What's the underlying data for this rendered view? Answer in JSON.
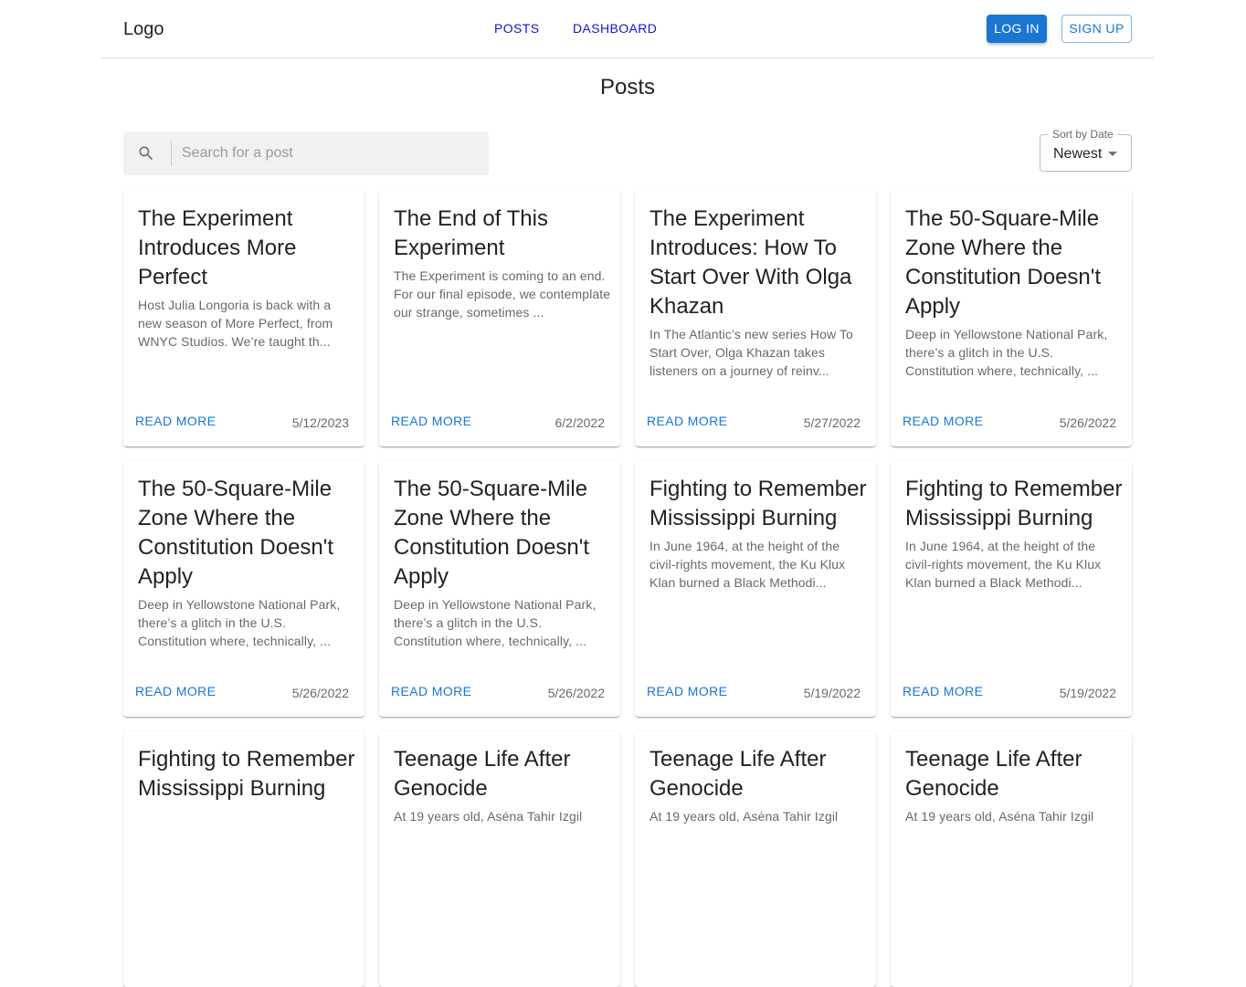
{
  "nav": {
    "logo": "Logo",
    "links": [
      "POSTS",
      "DASHBOARD"
    ],
    "login_label": "LOG IN",
    "signup_label": "SIGN UP"
  },
  "page": {
    "title": "Posts"
  },
  "search": {
    "placeholder": "Search for a post",
    "value": ""
  },
  "sort": {
    "label": "Sort by Date",
    "value": "Newest"
  },
  "colors": {
    "primary": "#1976d2",
    "nav_link": "#1515cc",
    "search_bg": "#f1f1f1"
  },
  "read_more_label": "READ MORE",
  "posts": [
    {
      "title": "The Experiment Introduces More Perfect",
      "excerpt": "Host Julia Longoria is back with a new season of More Perfect, from WNYC Studios. We’re taught th...",
      "date": "5/12/2023"
    },
    {
      "title": "The End of This Experiment",
      "excerpt": "The Experiment is coming to an end. For our final episode, we contemplate our strange, sometimes ...",
      "date": "6/2/2022"
    },
    {
      "title": "The Experiment Introduces: How To Start Over With Olga Khazan",
      "excerpt": "In The Atlantic’s new series How To Start Over, Olga Khazan takes listeners on a journey of reinv...",
      "date": "5/27/2022"
    },
    {
      "title": "The 50-Square-Mile Zone Where the Constitution Doesn't Apply",
      "excerpt": "Deep in Yellowstone National Park, there’s a glitch in the U.S. Constitution where, technically, ...",
      "date": "5/26/2022"
    },
    {
      "title": "The 50-Square-Mile Zone Where the Constitution Doesn't Apply",
      "excerpt": "Deep in Yellowstone National Park, there’s a glitch in the U.S. Constitution where, technically, ...",
      "date": "5/26/2022"
    },
    {
      "title": "The 50-Square-Mile Zone Where the Constitution Doesn't Apply",
      "excerpt": "Deep in Yellowstone National Park, there’s a glitch in the U.S. Constitution where, technically, ...",
      "date": "5/26/2022"
    },
    {
      "title": "Fighting to Remember Mississippi Burning",
      "excerpt": "In June 1964, at the height of the civil-rights movement, the Ku Klux Klan burned a Black Methodi...",
      "date": "5/19/2022"
    },
    {
      "title": "Fighting to Remember Mississippi Burning",
      "excerpt": "In June 1964, at the height of the civil-rights movement, the Ku Klux Klan burned a Black Methodi...",
      "date": "5/19/2022"
    },
    {
      "title": "Fighting to Remember Mississippi Burning",
      "excerpt": "",
      "date": ""
    },
    {
      "title": "Teenage Life After Genocide",
      "excerpt": "At 19 years old, Aséna Tahir Izgil",
      "date": ""
    },
    {
      "title": "Teenage Life After Genocide",
      "excerpt": "At 19 years old, Asėna Tahir Izgil",
      "date": ""
    },
    {
      "title": "Teenage Life After Genocide",
      "excerpt": "At 19 years old, Aséna Tahir Izgil",
      "date": ""
    }
  ]
}
